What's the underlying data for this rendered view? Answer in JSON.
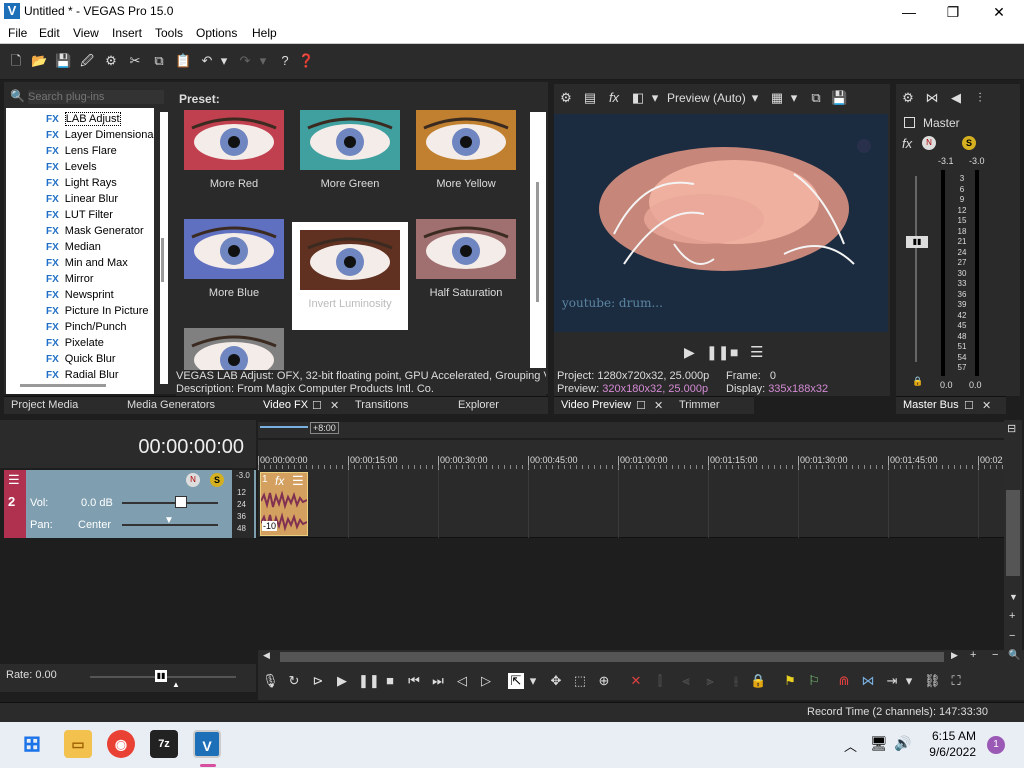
{
  "window": {
    "app_icon": "V",
    "title": "Untitled * - VEGAS Pro 15.0",
    "minimize": "—",
    "maximize": "❐",
    "close": "✕"
  },
  "menu": [
    "File",
    "Edit",
    "View",
    "Insert",
    "Tools",
    "Options",
    "Help"
  ],
  "toolbar_icons": [
    "new-icon",
    "open-icon",
    "save-icon",
    "save-as-icon",
    "properties-icon",
    "cut-icon",
    "copy-icon",
    "paste-icon",
    "undo-icon",
    "redo-icon",
    "whats-this-icon"
  ],
  "plugins": {
    "search_placeholder": "Search plug-ins",
    "preset_label": "Preset:",
    "tree": [
      {
        "fx": "FX",
        "label": "LAB Adjust"
      },
      {
        "fx": "FX",
        "label": "Layer Dimensional"
      },
      {
        "fx": "FX",
        "label": "Lens Flare"
      },
      {
        "fx": "FX",
        "label": "Levels"
      },
      {
        "fx": "FX",
        "label": "Light Rays"
      },
      {
        "fx": "FX",
        "label": "Linear Blur"
      },
      {
        "fx": "FX",
        "label": "LUT Filter"
      },
      {
        "fx": "FX",
        "label": "Mask Generator"
      },
      {
        "fx": "FX",
        "label": "Median"
      },
      {
        "fx": "FX",
        "label": "Min and Max"
      },
      {
        "fx": "FX",
        "label": "Mirror"
      },
      {
        "fx": "FX",
        "label": "Newsprint"
      },
      {
        "fx": "FX",
        "label": "Picture In Picture"
      },
      {
        "fx": "FX",
        "label": "Pinch/Punch"
      },
      {
        "fx": "FX",
        "label": "Pixelate"
      },
      {
        "fx": "FX",
        "label": "Quick Blur"
      },
      {
        "fx": "FX",
        "label": "Radial Blur"
      }
    ],
    "presets": [
      {
        "label": "More Red",
        "color": "#c04050"
      },
      {
        "label": "More Green",
        "color": "#40a0a0"
      },
      {
        "label": "More Yellow",
        "color": "#c08030"
      },
      {
        "label": "More Blue",
        "color": "#6070c0"
      },
      {
        "label": "Invert Luminosity",
        "color": "#603020"
      },
      {
        "label": "Half Saturation",
        "color": "#a07070"
      },
      {
        "label": "",
        "color": "#808080"
      }
    ],
    "desc_line1": "VEGAS LAB Adjust: OFX, 32-bit floating point, GPU Accelerated, Grouping VE",
    "desc_line2": "Description: From Magix Computer Products Intl. Co."
  },
  "tabs_left": [
    "Project Media",
    "Media Generators",
    "Video FX",
    "Transitions",
    "Explorer"
  ],
  "preview": {
    "mode": "Preview (Auto)",
    "watermark": "youtube: drum...",
    "project_label": "Project:",
    "project_value": "1280x720x32, 25.000p",
    "frame_label": "Frame:",
    "frame_value": "0",
    "preview_label": "Preview:",
    "preview_value": "320x180x32, 25.000p",
    "display_label": "Display:",
    "display_value": "335x188x32",
    "tab1": "Video Preview",
    "tab2": "Trimmer"
  },
  "master": {
    "label": "Master",
    "left_peak": "-3.1",
    "right_peak": "-3.0",
    "ticks": [
      "3",
      "6",
      "9",
      "12",
      "15",
      "18",
      "21",
      "24",
      "27",
      "30",
      "33",
      "36",
      "39",
      "42",
      "45",
      "48",
      "51",
      "54",
      "57"
    ],
    "bottom_left": "0.0",
    "bottom_right": "0.0",
    "tab": "Master Bus"
  },
  "timeline": {
    "timecode": "00:00:00:00",
    "zoom_label": "+8:00",
    "ruler": [
      "00:00:00:00",
      "00:00:15:00",
      "00:00:30:00",
      "00:00:45:00",
      "00:01:00:00",
      "00:01:15:00",
      "00:01:30:00",
      "00:01:45:00",
      "00:02"
    ],
    "track_number": "2",
    "vol_label": "Vol:",
    "vol_value": "0.0 dB",
    "pan_label": "Pan:",
    "pan_value": "Center",
    "meter_top": "-3.0",
    "meter_ticks": [
      "12",
      "24",
      "36",
      "48"
    ],
    "event_number": "1",
    "event_gain": "-10",
    "rate_label": "Rate: 0.00",
    "status": "Record Time (2 channels): 147:33:30"
  },
  "taskbar": {
    "time": "6:15 AM",
    "date": "9/6/2022",
    "notif": "1"
  }
}
